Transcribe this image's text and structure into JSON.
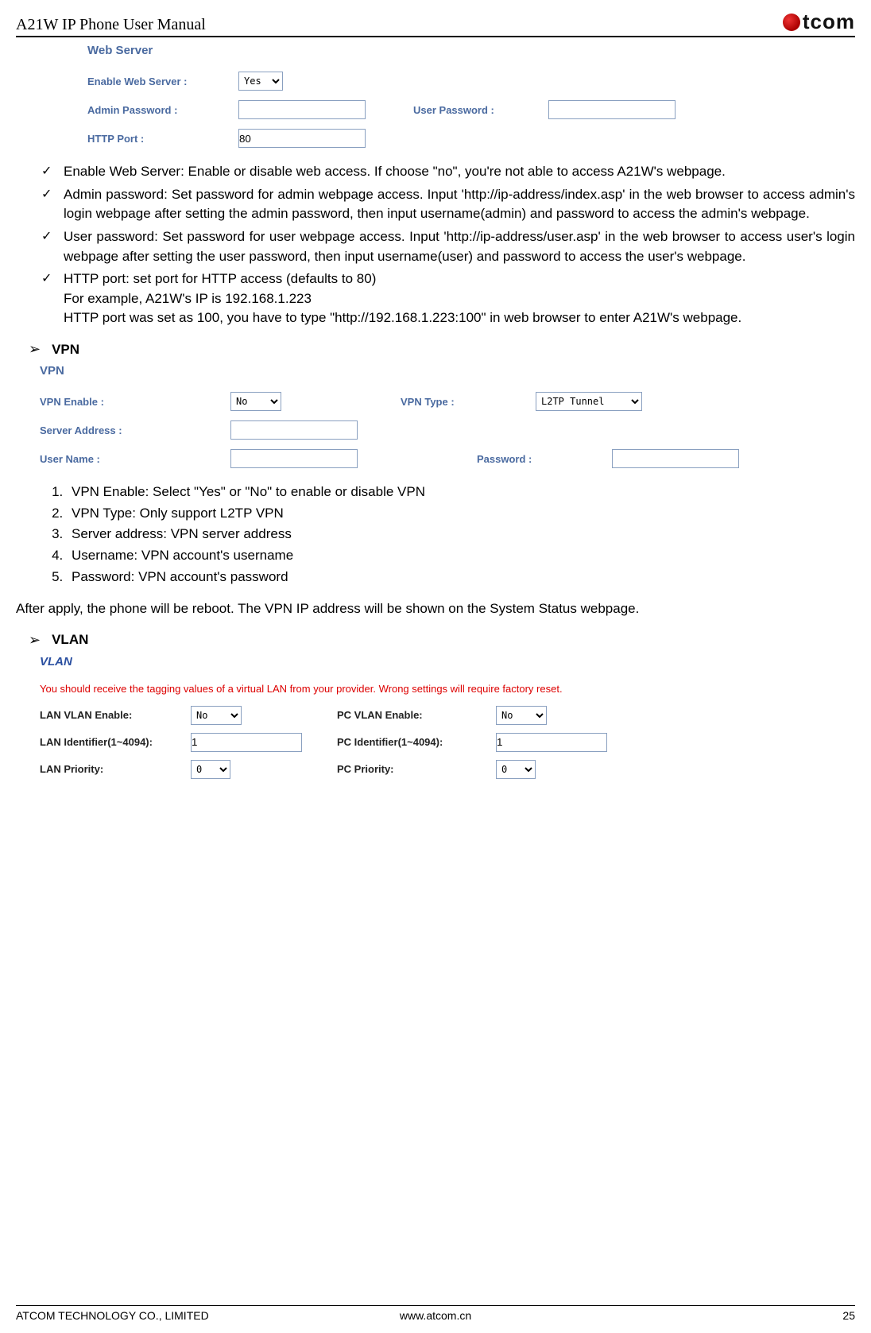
{
  "header": {
    "doc_title": "A21W IP Phone User Manual",
    "brand": "tcom"
  },
  "webserver": {
    "panel_title": "Web Server",
    "enable_label": "Enable Web Server :",
    "enable_value": "Yes",
    "admin_pw_label": "Admin Password :",
    "user_pw_label": "User Password :",
    "http_port_label": "HTTP Port :",
    "http_port_value": "80"
  },
  "bullets_ws": {
    "b1": "Enable Web Server: Enable or disable web access. If choose \"no\", you're not able to access A21W's webpage.",
    "b2": "Admin password: Set password for admin webpage access. Input 'http://ip-address/index.asp' in the web browser to access admin's login webpage after setting the admin password, then input username(admin) and password to access the admin's webpage.",
    "b3": "User password: Set password for user webpage access. Input 'http://ip-address/user.asp' in the web browser to access user's login webpage after setting the user password, then input username(user) and password to access the user's webpage.",
    "b4a": "HTTP port: set port for HTTP access (defaults to 80)",
    "b4b": "For example, A21W's IP is 192.168.1.223",
    "b4c": "HTTP port was set as 100, you have to type \"http://192.168.1.223:100\" in web browser to enter A21W's webpage."
  },
  "vpn": {
    "section_label": "VPN",
    "panel_title": "VPN",
    "enable_label": "VPN Enable :",
    "enable_value": "No",
    "type_label": "VPN Type :",
    "type_value": "L2TP Tunnel",
    "server_label": "Server Address :",
    "user_label": "User Name :",
    "pw_label": "Password :",
    "list": {
      "n1": "VPN Enable: Select \"Yes\" or \"No\" to enable or disable VPN",
      "n2": "VPN Type: Only support L2TP VPN",
      "n3": "Server address: VPN server address",
      "n4": "Username: VPN account's username",
      "n5": "Password: VPN account's password"
    },
    "after": "After apply, the phone will be reboot. The VPN IP address will be shown on the System Status webpage."
  },
  "vlan": {
    "section_label": "VLAN",
    "panel_title": "VLAN",
    "note": "You should receive the tagging values of a virtual LAN from your provider. Wrong settings will require factory reset.",
    "lan_enable_label": "LAN VLAN Enable:",
    "lan_enable_value": "No",
    "pc_enable_label": "PC VLAN Enable:",
    "pc_enable_value": "No",
    "lan_id_label": "LAN Identifier(1~4094):",
    "lan_id_value": "1",
    "pc_id_label": "PC Identifier(1~4094):",
    "pc_id_value": "1",
    "lan_prio_label": "LAN Priority:",
    "lan_prio_value": "0",
    "pc_prio_label": "PC Priority:",
    "pc_prio_value": "0"
  },
  "footer": {
    "left": "ATCOM TECHNOLOGY CO., LIMITED",
    "mid": "www.atcom.cn",
    "right": "25"
  }
}
